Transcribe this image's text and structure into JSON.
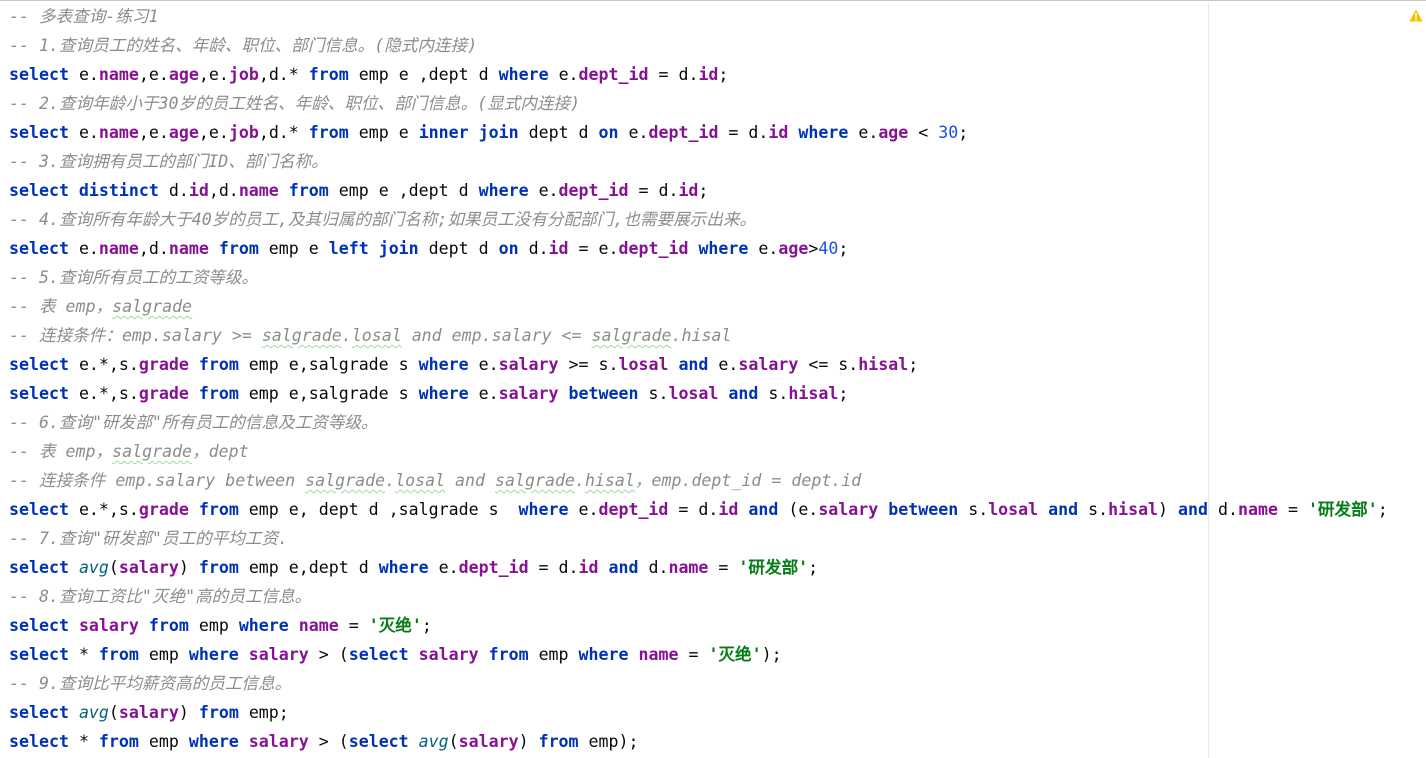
{
  "editor": {
    "lines": [
      [
        {
          "t": "cmt",
          "s": "-- 多表查询-练习1"
        }
      ],
      [
        {
          "t": "cmt",
          "s": "-- 1.查询员工的姓名、年龄、职位、部门信息。(隐式内连接)"
        }
      ],
      [
        {
          "t": "kw",
          "s": "select "
        },
        {
          "t": "plain",
          "s": "e."
        },
        {
          "t": "fld",
          "s": "name"
        },
        {
          "t": "plain",
          "s": ",e."
        },
        {
          "t": "fld",
          "s": "age"
        },
        {
          "t": "plain",
          "s": ",e."
        },
        {
          "t": "fld",
          "s": "job"
        },
        {
          "t": "plain",
          "s": ",d.* "
        },
        {
          "t": "kw",
          "s": "from "
        },
        {
          "t": "plain",
          "s": "emp e ,dept d "
        },
        {
          "t": "kw",
          "s": "where "
        },
        {
          "t": "plain",
          "s": "e."
        },
        {
          "t": "fld",
          "s": "dept_id"
        },
        {
          "t": "plain",
          "s": " = d."
        },
        {
          "t": "fld",
          "s": "id"
        },
        {
          "t": "plain",
          "s": ";"
        }
      ],
      [
        {
          "t": "cmt",
          "s": "-- 2.查询年龄小于30岁的员工姓名、年龄、职位、部门信息。(显式内连接)"
        }
      ],
      [
        {
          "t": "kw",
          "s": "select "
        },
        {
          "t": "plain",
          "s": "e."
        },
        {
          "t": "fld",
          "s": "name"
        },
        {
          "t": "plain",
          "s": ",e."
        },
        {
          "t": "fld",
          "s": "age"
        },
        {
          "t": "plain",
          "s": ",e."
        },
        {
          "t": "fld",
          "s": "job"
        },
        {
          "t": "plain",
          "s": ",d.* "
        },
        {
          "t": "kw",
          "s": "from "
        },
        {
          "t": "plain",
          "s": "emp e "
        },
        {
          "t": "kw",
          "s": "inner join "
        },
        {
          "t": "plain",
          "s": "dept d "
        },
        {
          "t": "kw",
          "s": "on "
        },
        {
          "t": "plain",
          "s": "e."
        },
        {
          "t": "fld",
          "s": "dept_id"
        },
        {
          "t": "plain",
          "s": " = d."
        },
        {
          "t": "fld",
          "s": "id"
        },
        {
          "t": "plain",
          "s": " "
        },
        {
          "t": "kw",
          "s": "where "
        },
        {
          "t": "plain",
          "s": "e."
        },
        {
          "t": "fld",
          "s": "age"
        },
        {
          "t": "plain",
          "s": " < "
        },
        {
          "t": "num",
          "s": "30"
        },
        {
          "t": "plain",
          "s": ";"
        }
      ],
      [
        {
          "t": "cmt",
          "s": "-- 3.查询拥有员工的部门ID、部门名称。"
        }
      ],
      [
        {
          "t": "kw",
          "s": "select distinct "
        },
        {
          "t": "plain",
          "s": "d."
        },
        {
          "t": "fld",
          "s": "id"
        },
        {
          "t": "plain",
          "s": ",d."
        },
        {
          "t": "fld",
          "s": "name"
        },
        {
          "t": "plain",
          "s": " "
        },
        {
          "t": "kw",
          "s": "from "
        },
        {
          "t": "plain",
          "s": "emp e ,dept d "
        },
        {
          "t": "kw",
          "s": "where "
        },
        {
          "t": "plain",
          "s": "e."
        },
        {
          "t": "fld",
          "s": "dept_id"
        },
        {
          "t": "plain",
          "s": " = d."
        },
        {
          "t": "fld",
          "s": "id"
        },
        {
          "t": "plain",
          "s": ";"
        }
      ],
      [
        {
          "t": "cmt",
          "s": "-- 4.查询所有年龄大于40岁的员工,及其归属的部门名称;如果员工没有分配部门,也需要展示出来。"
        }
      ],
      [
        {
          "t": "kw",
          "s": "select "
        },
        {
          "t": "plain",
          "s": "e."
        },
        {
          "t": "fld",
          "s": "name"
        },
        {
          "t": "plain",
          "s": ",d."
        },
        {
          "t": "fld",
          "s": "name"
        },
        {
          "t": "plain",
          "s": " "
        },
        {
          "t": "kw",
          "s": "from "
        },
        {
          "t": "plain",
          "s": "emp e "
        },
        {
          "t": "kw",
          "s": "left join "
        },
        {
          "t": "plain",
          "s": "dept d "
        },
        {
          "t": "kw",
          "s": "on "
        },
        {
          "t": "plain",
          "s": "d."
        },
        {
          "t": "fld",
          "s": "id"
        },
        {
          "t": "plain",
          "s": " = e."
        },
        {
          "t": "fld",
          "s": "dept_id"
        },
        {
          "t": "plain",
          "s": " "
        },
        {
          "t": "kw",
          "s": "where "
        },
        {
          "t": "plain",
          "s": "e."
        },
        {
          "t": "fld",
          "s": "age"
        },
        {
          "t": "plain",
          "s": ">"
        },
        {
          "t": "num",
          "s": "40"
        },
        {
          "t": "plain",
          "s": ";"
        }
      ],
      [
        {
          "t": "cmt",
          "s": "-- 5.查询所有员工的工资等级。"
        }
      ],
      [
        {
          "t": "cmt",
          "s": "-- 表 emp，"
        },
        {
          "t": "cmt squig",
          "s": "salgrade"
        }
      ],
      [
        {
          "t": "cmt",
          "s": "-- 连接条件：emp.salary >= "
        },
        {
          "t": "cmt squig",
          "s": "salgrade"
        },
        {
          "t": "cmt",
          "s": "."
        },
        {
          "t": "cmt squig",
          "s": "losal"
        },
        {
          "t": "cmt",
          "s": " and emp.salary <= "
        },
        {
          "t": "cmt squig",
          "s": "salgrade"
        },
        {
          "t": "cmt",
          "s": ".hisal"
        }
      ],
      [
        {
          "t": "kw",
          "s": "select "
        },
        {
          "t": "plain",
          "s": "e.*,s."
        },
        {
          "t": "fld",
          "s": "grade"
        },
        {
          "t": "plain",
          "s": " "
        },
        {
          "t": "kw",
          "s": "from "
        },
        {
          "t": "plain",
          "s": "emp e,salgrade s "
        },
        {
          "t": "kw",
          "s": "where "
        },
        {
          "t": "plain",
          "s": "e."
        },
        {
          "t": "fld",
          "s": "salary"
        },
        {
          "t": "plain",
          "s": " >= s."
        },
        {
          "t": "fld",
          "s": "losal"
        },
        {
          "t": "plain",
          "s": " "
        },
        {
          "t": "kw",
          "s": "and "
        },
        {
          "t": "plain",
          "s": "e."
        },
        {
          "t": "fld",
          "s": "salary"
        },
        {
          "t": "plain",
          "s": " <= s."
        },
        {
          "t": "fld",
          "s": "hisal"
        },
        {
          "t": "plain",
          "s": ";"
        }
      ],
      [
        {
          "t": "kw",
          "s": "select "
        },
        {
          "t": "plain",
          "s": "e.*,s."
        },
        {
          "t": "fld",
          "s": "grade"
        },
        {
          "t": "plain",
          "s": " "
        },
        {
          "t": "kw",
          "s": "from "
        },
        {
          "t": "plain",
          "s": "emp e,salgrade s "
        },
        {
          "t": "kw",
          "s": "where "
        },
        {
          "t": "plain",
          "s": "e."
        },
        {
          "t": "fld",
          "s": "salary"
        },
        {
          "t": "plain",
          "s": " "
        },
        {
          "t": "kw",
          "s": "between "
        },
        {
          "t": "plain",
          "s": "s."
        },
        {
          "t": "fld",
          "s": "losal"
        },
        {
          "t": "plain",
          "s": " "
        },
        {
          "t": "kw",
          "s": "and "
        },
        {
          "t": "plain",
          "s": "s."
        },
        {
          "t": "fld",
          "s": "hisal"
        },
        {
          "t": "plain",
          "s": ";"
        }
      ],
      [
        {
          "t": "cmt",
          "s": "-- 6.查询\"研发部\"所有员工的信息及工资等级。"
        }
      ],
      [
        {
          "t": "cmt",
          "s": "-- 表 emp，"
        },
        {
          "t": "cmt squig",
          "s": "salgrade"
        },
        {
          "t": "cmt",
          "s": "，dept"
        }
      ],
      [
        {
          "t": "cmt",
          "s": "-- 连接条件 emp.salary between "
        },
        {
          "t": "cmt squig",
          "s": "salgrade"
        },
        {
          "t": "cmt",
          "s": "."
        },
        {
          "t": "cmt squig",
          "s": "losal"
        },
        {
          "t": "cmt",
          "s": " and "
        },
        {
          "t": "cmt squig",
          "s": "salgrade"
        },
        {
          "t": "cmt",
          "s": "."
        },
        {
          "t": "cmt squig",
          "s": "hisal"
        },
        {
          "t": "cmt",
          "s": "，emp.dept_id = dept.id"
        }
      ],
      [
        {
          "t": "kw",
          "s": "select "
        },
        {
          "t": "plain",
          "s": "e.*,s."
        },
        {
          "t": "fld",
          "s": "grade"
        },
        {
          "t": "plain",
          "s": " "
        },
        {
          "t": "kw",
          "s": "from "
        },
        {
          "t": "plain",
          "s": "emp e, dept d ,salgrade s  "
        },
        {
          "t": "kw",
          "s": "where "
        },
        {
          "t": "plain",
          "s": "e."
        },
        {
          "t": "fld",
          "s": "dept_id"
        },
        {
          "t": "plain",
          "s": " = d."
        },
        {
          "t": "fld",
          "s": "id"
        },
        {
          "t": "plain",
          "s": " "
        },
        {
          "t": "kw",
          "s": "and "
        },
        {
          "t": "plain",
          "s": "(e."
        },
        {
          "t": "fld",
          "s": "salary"
        },
        {
          "t": "plain",
          "s": " "
        },
        {
          "t": "kw",
          "s": "between "
        },
        {
          "t": "plain",
          "s": "s."
        },
        {
          "t": "fld",
          "s": "losal"
        },
        {
          "t": "plain",
          "s": " "
        },
        {
          "t": "kw",
          "s": "and "
        },
        {
          "t": "plain",
          "s": "s."
        },
        {
          "t": "fld",
          "s": "hisal"
        },
        {
          "t": "plain",
          "s": ") "
        },
        {
          "t": "kw",
          "s": "and "
        },
        {
          "t": "plain",
          "s": "d."
        },
        {
          "t": "fld",
          "s": "name"
        },
        {
          "t": "plain",
          "s": " = "
        },
        {
          "t": "str",
          "s": "'研发部'"
        },
        {
          "t": "plain",
          "s": ";"
        }
      ],
      [
        {
          "t": "cmt",
          "s": "-- 7.查询\"研发部\"员工的平均工资."
        }
      ],
      [
        {
          "t": "kw",
          "s": "select "
        },
        {
          "t": "fn",
          "s": "avg"
        },
        {
          "t": "plain",
          "s": "("
        },
        {
          "t": "fld",
          "s": "salary"
        },
        {
          "t": "plain",
          "s": ") "
        },
        {
          "t": "kw",
          "s": "from "
        },
        {
          "t": "plain",
          "s": "emp e,dept d "
        },
        {
          "t": "kw",
          "s": "where "
        },
        {
          "t": "plain",
          "s": "e."
        },
        {
          "t": "fld",
          "s": "dept_id"
        },
        {
          "t": "plain",
          "s": " = d."
        },
        {
          "t": "fld",
          "s": "id"
        },
        {
          "t": "plain",
          "s": " "
        },
        {
          "t": "kw",
          "s": "and "
        },
        {
          "t": "plain",
          "s": "d."
        },
        {
          "t": "fld",
          "s": "name"
        },
        {
          "t": "plain",
          "s": " = "
        },
        {
          "t": "str",
          "s": "'研发部'"
        },
        {
          "t": "plain",
          "s": ";"
        }
      ],
      [
        {
          "t": "cmt",
          "s": "-- 8.查询工资比\"灭绝\"高的员工信息。"
        }
      ],
      [
        {
          "t": "kw",
          "s": "select "
        },
        {
          "t": "fld",
          "s": "salary"
        },
        {
          "t": "plain",
          "s": " "
        },
        {
          "t": "kw",
          "s": "from "
        },
        {
          "t": "plain",
          "s": "emp "
        },
        {
          "t": "kw",
          "s": "where "
        },
        {
          "t": "fld",
          "s": "name"
        },
        {
          "t": "plain",
          "s": " = "
        },
        {
          "t": "str",
          "s": "'灭绝'"
        },
        {
          "t": "plain",
          "s": ";"
        }
      ],
      [
        {
          "t": "kw",
          "s": "select "
        },
        {
          "t": "plain",
          "s": "* "
        },
        {
          "t": "kw",
          "s": "from "
        },
        {
          "t": "plain",
          "s": "emp "
        },
        {
          "t": "kw",
          "s": "where "
        },
        {
          "t": "fld",
          "s": "salary"
        },
        {
          "t": "plain",
          "s": " > ("
        },
        {
          "t": "kw",
          "s": "select "
        },
        {
          "t": "fld",
          "s": "salary"
        },
        {
          "t": "plain",
          "s": " "
        },
        {
          "t": "kw",
          "s": "from "
        },
        {
          "t": "plain",
          "s": "emp "
        },
        {
          "t": "kw",
          "s": "where "
        },
        {
          "t": "fld",
          "s": "name"
        },
        {
          "t": "plain",
          "s": " = "
        },
        {
          "t": "str",
          "s": "'灭绝'"
        },
        {
          "t": "plain",
          "s": ");"
        }
      ],
      [
        {
          "t": "cmt",
          "s": "-- 9.查询比平均薪资高的员工信息。"
        }
      ],
      [
        {
          "t": "kw",
          "s": "select "
        },
        {
          "t": "fn",
          "s": "avg"
        },
        {
          "t": "plain",
          "s": "("
        },
        {
          "t": "fld",
          "s": "salary"
        },
        {
          "t": "plain",
          "s": ") "
        },
        {
          "t": "kw",
          "s": "from "
        },
        {
          "t": "plain",
          "s": "emp;"
        }
      ],
      [
        {
          "t": "kw",
          "s": "select "
        },
        {
          "t": "plain",
          "s": "* "
        },
        {
          "t": "kw",
          "s": "from "
        },
        {
          "t": "plain",
          "s": "emp "
        },
        {
          "t": "kw",
          "s": "where "
        },
        {
          "t": "fld",
          "s": "salary"
        },
        {
          "t": "plain",
          "s": " > ("
        },
        {
          "t": "kw",
          "s": "select "
        },
        {
          "t": "fn",
          "s": "avg"
        },
        {
          "t": "plain",
          "s": "("
        },
        {
          "t": "fld",
          "s": "salary"
        },
        {
          "t": "plain",
          "s": ") "
        },
        {
          "t": "kw",
          "s": "from "
        },
        {
          "t": "plain",
          "s": "emp);"
        }
      ]
    ]
  },
  "status": {
    "warning_icon": "warning-icon",
    "warning_color": "#f2c200"
  },
  "colors": {
    "keyword": "#0033b3",
    "field": "#871094",
    "string": "#067d17",
    "number": "#1750eb",
    "comment": "#8c8c8c",
    "function": "#00627a"
  }
}
